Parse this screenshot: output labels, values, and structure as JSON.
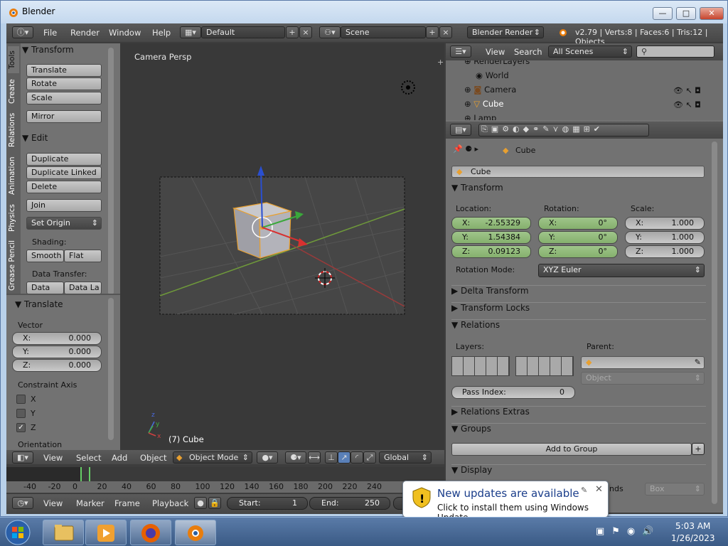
{
  "window": {
    "title": "Blender",
    "min_label": "—",
    "max_label": "□",
    "close_label": "✕"
  },
  "infobar": {
    "menus": [
      "File",
      "Render",
      "Window",
      "Help"
    ],
    "screen_layout": "Default",
    "scene": "Scene",
    "render_engine": "Blender Render",
    "stats": "v2.79 | Verts:8 | Faces:6 | Tris:12 | Objects"
  },
  "toolshelf": {
    "tabs": [
      "Tools",
      "Create",
      "Relations",
      "Animation",
      "Physics",
      "Grease Pencil"
    ],
    "transform": {
      "header": "Transform",
      "buttons": [
        "Translate",
        "Rotate",
        "Scale"
      ],
      "mirror": "Mirror"
    },
    "edit": {
      "header": "Edit",
      "buttons": [
        "Duplicate",
        "Duplicate Linked",
        "Delete"
      ],
      "join": "Join",
      "set_origin": "Set Origin",
      "shading_label": "Shading:",
      "smooth": "Smooth",
      "flat": "Flat",
      "data_transfer_label": "Data Transfer:",
      "data": "Data",
      "data_la": "Data La"
    }
  },
  "operator": {
    "header": "Translate",
    "vector_label": "Vector",
    "vector": [
      {
        "k": "X:",
        "v": "0.000"
      },
      {
        "k": "Y:",
        "v": "0.000"
      },
      {
        "k": "Z:",
        "v": "0.000"
      }
    ],
    "constraint_label": "Constraint Axis",
    "axes": [
      {
        "k": "X",
        "checked": false
      },
      {
        "k": "Y",
        "checked": false
      },
      {
        "k": "Z",
        "checked": true
      }
    ],
    "orientation_label": "Orientation"
  },
  "viewport": {
    "view_name": "Camera Persp",
    "object_label": "(7) Cube"
  },
  "view3d_header": {
    "menus": [
      "View",
      "Select",
      "Add",
      "Object"
    ],
    "mode": "Object Mode",
    "orientation": "Global"
  },
  "timeline": {
    "ticks": [
      "-40",
      "-20",
      "0",
      "20",
      "40",
      "60",
      "80",
      "100",
      "120",
      "140",
      "160",
      "180",
      "200",
      "220",
      "240"
    ],
    "menus": [
      "View",
      "Marker",
      "Frame",
      "Playback"
    ],
    "start_label": "Start:",
    "start": "1",
    "end_label": "End:",
    "end": "250"
  },
  "outliner": {
    "view": "View",
    "search": "Search",
    "filter": "All Scenes",
    "items": [
      "RenderLayers",
      "World",
      "Camera",
      "Cube",
      "Lamp"
    ]
  },
  "properties": {
    "breadcrumb": "Cube",
    "object_name": "Cube",
    "transform_header": "Transform",
    "location_label": "Location:",
    "rotation_label": "Rotation:",
    "scale_label": "Scale:",
    "location": [
      {
        "k": "X:",
        "v": "-2.55329"
      },
      {
        "k": "Y:",
        "v": "1.54384"
      },
      {
        "k": "Z:",
        "v": "0.09123"
      }
    ],
    "rotation": [
      {
        "k": "X:",
        "v": "0°"
      },
      {
        "k": "Y:",
        "v": "0°"
      },
      {
        "k": "Z:",
        "v": "0°"
      }
    ],
    "scale": [
      {
        "k": "X:",
        "v": "1.000"
      },
      {
        "k": "Y:",
        "v": "1.000"
      },
      {
        "k": "Z:",
        "v": "1.000"
      }
    ],
    "rotation_mode_label": "Rotation Mode:",
    "rotation_mode": "XYZ Euler",
    "delta_transform": "Delta Transform",
    "transform_locks": "Transform Locks",
    "relations": "Relations",
    "layers_label": "Layers:",
    "parent_label": "Parent:",
    "parent_type": "Object",
    "pass_index_label": "Pass Index:",
    "pass_index": "0",
    "relations_extras": "Relations Extras",
    "groups": "Groups",
    "add_to_group": "Add to Group",
    "display": "Display",
    "bounds_suffix": "nds",
    "bounds_type": "Box"
  },
  "notification": {
    "title": "New updates are available",
    "body": "Click to install them using Windows Update."
  },
  "clock": {
    "time": "5:03 AM",
    "date": "1/26/2023"
  }
}
